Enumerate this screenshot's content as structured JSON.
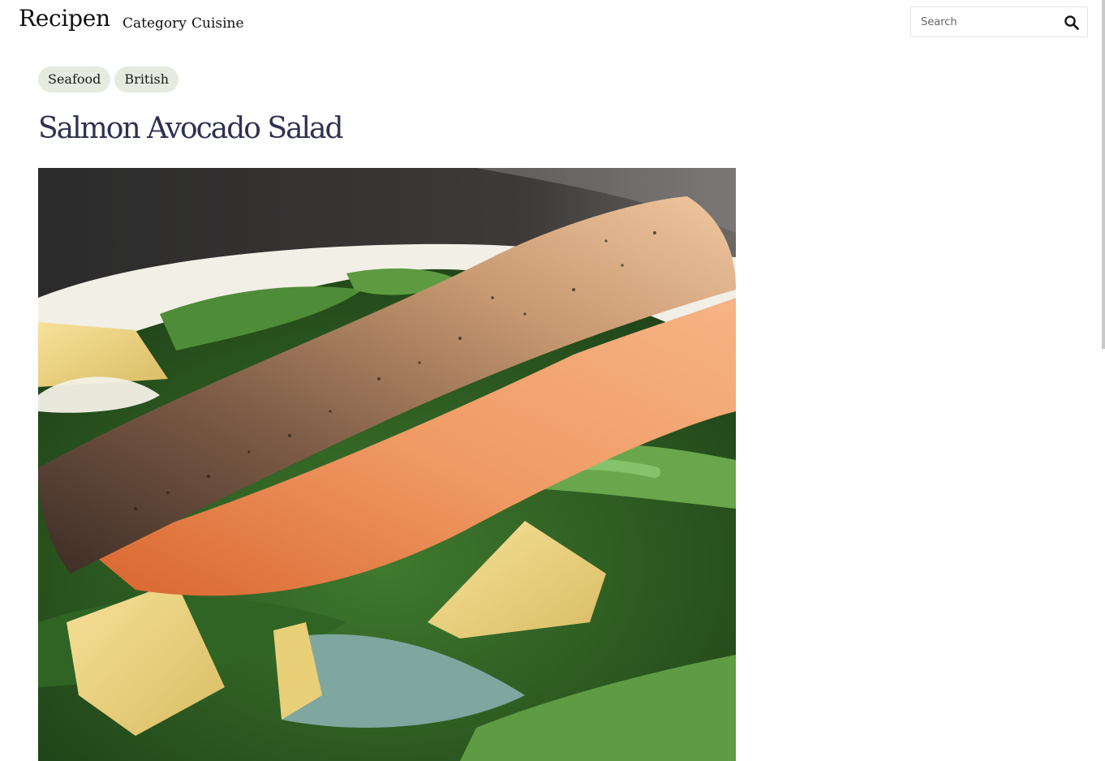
{
  "header": {
    "logo": "Recipen",
    "nav": [
      {
        "label": "Category"
      },
      {
        "label": "Cuisine"
      }
    ],
    "search": {
      "placeholder": "Search",
      "value": "",
      "icon": "search-icon"
    }
  },
  "recipe": {
    "tags": [
      "Seafood",
      "British"
    ],
    "title": "Salmon Avocado Salad",
    "image_icon": "recipe-photo"
  },
  "colors": {
    "tag_bg": "#e6ebdf",
    "title": "#2e3150"
  }
}
